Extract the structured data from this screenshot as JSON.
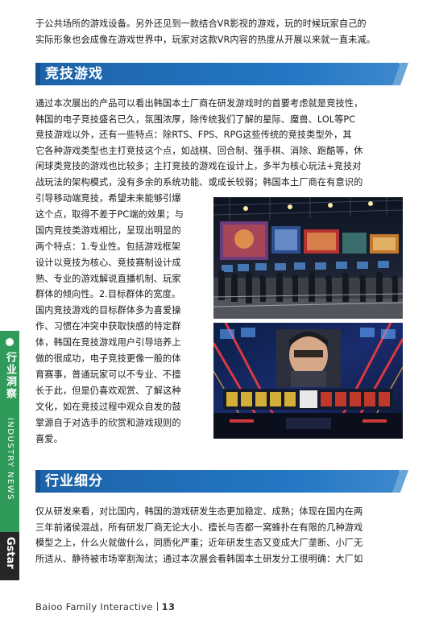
{
  "intro_lines": [
    "于公共场所的游戏设备。另外还见到一款结合VR影视的游戏，玩的时候玩家自己的",
    "实际形象也会成像在游戏世界中，玩家对这款VR内容的热度从开展以来就一直未减。"
  ],
  "section1": {
    "title": "竞技游戏",
    "full_lines": [
      "通过本次展出的产品可以看出韩国本土厂商在研发游戏时的首要考虑就是竞技性，",
      "韩国的电子竞技盛名已久，氛围浓厚，除传统我们了解的星际、魔兽、LOL等PC",
      "竞技游戏以外，还有一些特点：除RTS、FPS、RPG这些传统的竞技类型外，其",
      "它各种游戏类型也主打竞技这个点，如战棋、回合制、强手棋、消除、跑酷等，休",
      "闲球类竞技的游戏也比较多；主打竞技的游戏在设计上，多半为核心玩法+竞技对",
      "战玩法的架构模式，没有多余的系统功能、或成长较弱；韩国本土厂商在有意识的"
    ],
    "narrow_lines": [
      "引导移动端竞技，希望未来能够引爆",
      "这个点，取得不差于PC端的效果；与",
      "国内竞技类游戏相比，呈现出明显的",
      "两个特点：1.专业性。包括游戏框架",
      "设计以竞技为核心、竞技赛制设计成",
      "熟、专业的游戏解说直播机制、玩家",
      "群体的倾向性。2.目标群体的宽度。",
      "国内竞技游戏的目标群体多为喜爱操",
      "作、习惯在冲突中获取快感的特定群",
      "体，韩国在竞技游戏用户引导培养上",
      "做的很成功，电子竞技更像一般的体",
      "育赛事，普通玩家可以不专业、不擅",
      "长于此，但是仍喜欢观赏、了解这种",
      "文化，如在竞技过程中观众自发的鼓",
      "掌源自于对选手的欣赏和游戏规则的",
      "喜爱。"
    ]
  },
  "section2": {
    "title": "行业细分",
    "lines": [
      "仅从研发来看，对比国内，韩国的游戏研发生态更加稳定、成熟；体现在国内在两",
      "三年前诸侯混战，所有研发厂商无论大小、擅长与否都一窝蜂扑在有限的几种游戏",
      "模型之上，什么火就做什么，同质化严重；近年研发生态又变成大厂垄断、小厂无",
      "所适从、静待被市场宰割淘汰；通过本次展会看韩国本土研发分工很明确：大厂如"
    ]
  },
  "side_tab": {
    "cn": "行业洞察",
    "en": "INDUSTRY NEWS",
    "brand": "Gstar"
  },
  "footer": {
    "company": "Baioo Family Interactive",
    "page": "13"
  }
}
